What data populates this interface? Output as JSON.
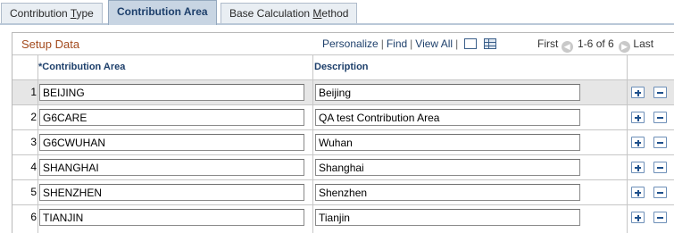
{
  "tabs": [
    {
      "prefix": "Contribution ",
      "underline": "T",
      "suffix": "ype"
    },
    {
      "prefix": "Contribution Area",
      "underline": "",
      "suffix": ""
    },
    {
      "prefix": "Base Calculation ",
      "underline": "M",
      "suffix": "ethod"
    }
  ],
  "grid": {
    "title": "Setup Data",
    "links": {
      "personalize": "Personalize",
      "find": "Find",
      "view_all": "View All"
    },
    "pager": {
      "first": "First",
      "range": "1-6 of 6",
      "last": "Last"
    },
    "columns": {
      "area": "*Contribution Area",
      "description": "Description"
    },
    "rows": [
      {
        "num": "1",
        "area": "BEIJING",
        "description": "Beijing"
      },
      {
        "num": "2",
        "area": "G6CARE",
        "description": "QA test Contribution Area"
      },
      {
        "num": "3",
        "area": "G6CWUHAN",
        "description": "Wuhan"
      },
      {
        "num": "4",
        "area": "SHANGHAI",
        "description": "Shanghai"
      },
      {
        "num": "5",
        "area": "SHENZHEN",
        "description": "Shenzhen"
      },
      {
        "num": "6",
        "area": "TIANJIN",
        "description": "Tianjin"
      }
    ]
  },
  "colors": {
    "accent": "#1d3f6b",
    "title": "#a34a1d",
    "alt_row": "#e6e6e6"
  }
}
